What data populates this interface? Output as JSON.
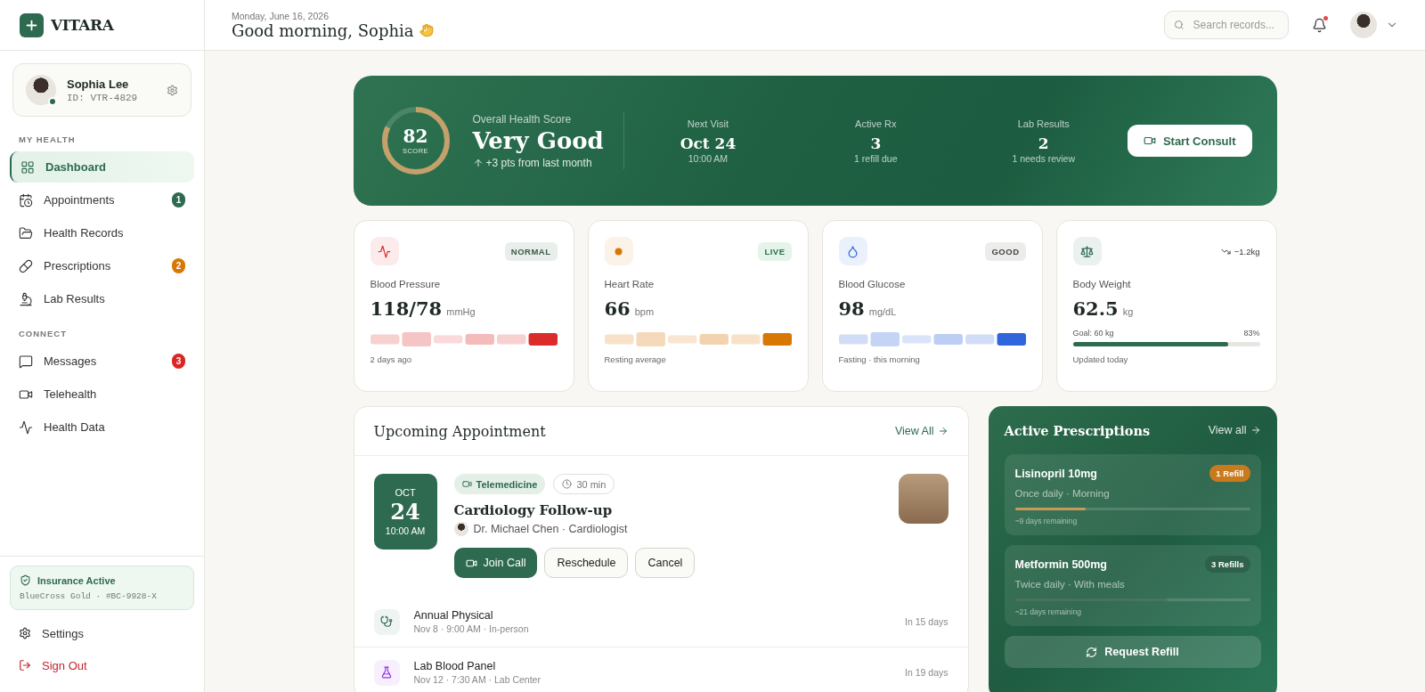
{
  "sidebar": {
    "brand": "VITARA",
    "profile": {
      "name": "Sophia Lee",
      "id": "ID: VTR-4829",
      "online": true
    },
    "sections": [
      {
        "title": "MY HEALTH",
        "items": [
          {
            "label": "Dashboard",
            "selected": true
          },
          {
            "label": "Appointments",
            "selected": false,
            "badge": "1",
            "color": "#2d6a4f"
          },
          {
            "label": "Health Records",
            "selected": false
          },
          {
            "label": "Prescriptions",
            "selected": false,
            "badge": "2",
            "color": "#d97706"
          },
          {
            "label": "Lab Results",
            "selected": false
          }
        ]
      },
      {
        "title": "CONNECT",
        "items": [
          {
            "label": "Messages",
            "selected": false,
            "badge": "3",
            "color": "#dc2626"
          },
          {
            "label": "Telehealth",
            "selected": false
          },
          {
            "label": "Health Data",
            "selected": false
          }
        ]
      }
    ],
    "insurance": {
      "title": "Insurance Active",
      "detail": "BlueCross Gold · #BC-9928-X"
    },
    "footer": [
      {
        "label": "Settings",
        "kind": "normal"
      },
      {
        "label": "Sign Out",
        "kind": "danger"
      }
    ]
  },
  "header": {
    "date": "Monday, June 16, 2026",
    "greeting": "Good morning, Sophia",
    "search": {
      "placeholder": "Search records..."
    },
    "unread": true
  },
  "hero": {
    "score": "82",
    "score_label": "SCORE",
    "level": 0.82,
    "title": "Overall Health Score",
    "rating": "Very Good",
    "change": "+3 pts from last month",
    "stats": [
      {
        "label": "Next Visit",
        "value": "Oct 24",
        "sub": "10:00 AM"
      },
      {
        "label": "Active Rx",
        "value": "3",
        "sub": "1 refill due"
      },
      {
        "label": "Lab Results",
        "value": "2",
        "sub": "1 needs review"
      }
    ],
    "button": "Start Consult"
  },
  "metrics": [
    {
      "kind": "bars",
      "color": "#dc2b2b",
      "label": "Blood Pressure",
      "value": "118/78",
      "unit": "mmHg",
      "badge": "NORMAL",
      "note": "2 days ago"
    },
    {
      "kind": "bars",
      "color": "#d97706",
      "label": "Heart Rate",
      "value": "66",
      "unit": "bpm",
      "badge": "LIVE",
      "note": "Resting average"
    },
    {
      "kind": "bars",
      "color": "#2f66db",
      "label": "Blood Glucose",
      "value": "98",
      "unit": "mg/dL",
      "badge": "GOOD",
      "note": "Fasting · this morning"
    },
    {
      "kind": "progress",
      "color": "#2d6a4f",
      "label": "Body Weight",
      "value": "62.5",
      "unit": "kg",
      "trend": "−1.2kg",
      "goal": "Goal: 60 kg",
      "percent": "83%",
      "level": 0.83,
      "note": "Updated today"
    }
  ],
  "appointments": {
    "title": "Upcoming Appointment",
    "link": "View All",
    "featured": {
      "month": "OCT",
      "day": "24",
      "time": "10:00 AM",
      "type": "Telemedicine",
      "duration": "30 min",
      "title": "Cardiology Follow-up",
      "doctor": "Dr. Michael Chen · Cardiologist",
      "buttons": [
        {
          "label": "Join Call",
          "kind": "primary"
        },
        {
          "label": "Reschedule",
          "kind": "secondary"
        },
        {
          "label": "Cancel",
          "kind": "secondary"
        }
      ]
    },
    "list": [
      {
        "title": "Annual Physical",
        "detail": "Nov 8 · 9:00 AM · In-person",
        "when": "In 15 days",
        "color": "#2d6a4f"
      },
      {
        "title": "Lab Blood Panel",
        "detail": "Nov 12 · 7:30 AM · Lab Center",
        "when": "In 19 days",
        "color": "#9333ea"
      }
    ]
  },
  "prescriptions": {
    "title": "Active Prescriptions",
    "link": "View all",
    "items": [
      {
        "name": "Lisinopril 10mg",
        "schedule": "Once daily · Morning",
        "badge": "1 Refill",
        "urgent": true,
        "level": 0.3,
        "remaining": "~9 days remaining"
      },
      {
        "name": "Metformin 500mg",
        "schedule": "Twice daily · With meals",
        "badge": "3 Refills",
        "urgent": false,
        "level": 0.65,
        "remaining": "~21 days remaining"
      }
    ],
    "button": "Request Refill"
  }
}
